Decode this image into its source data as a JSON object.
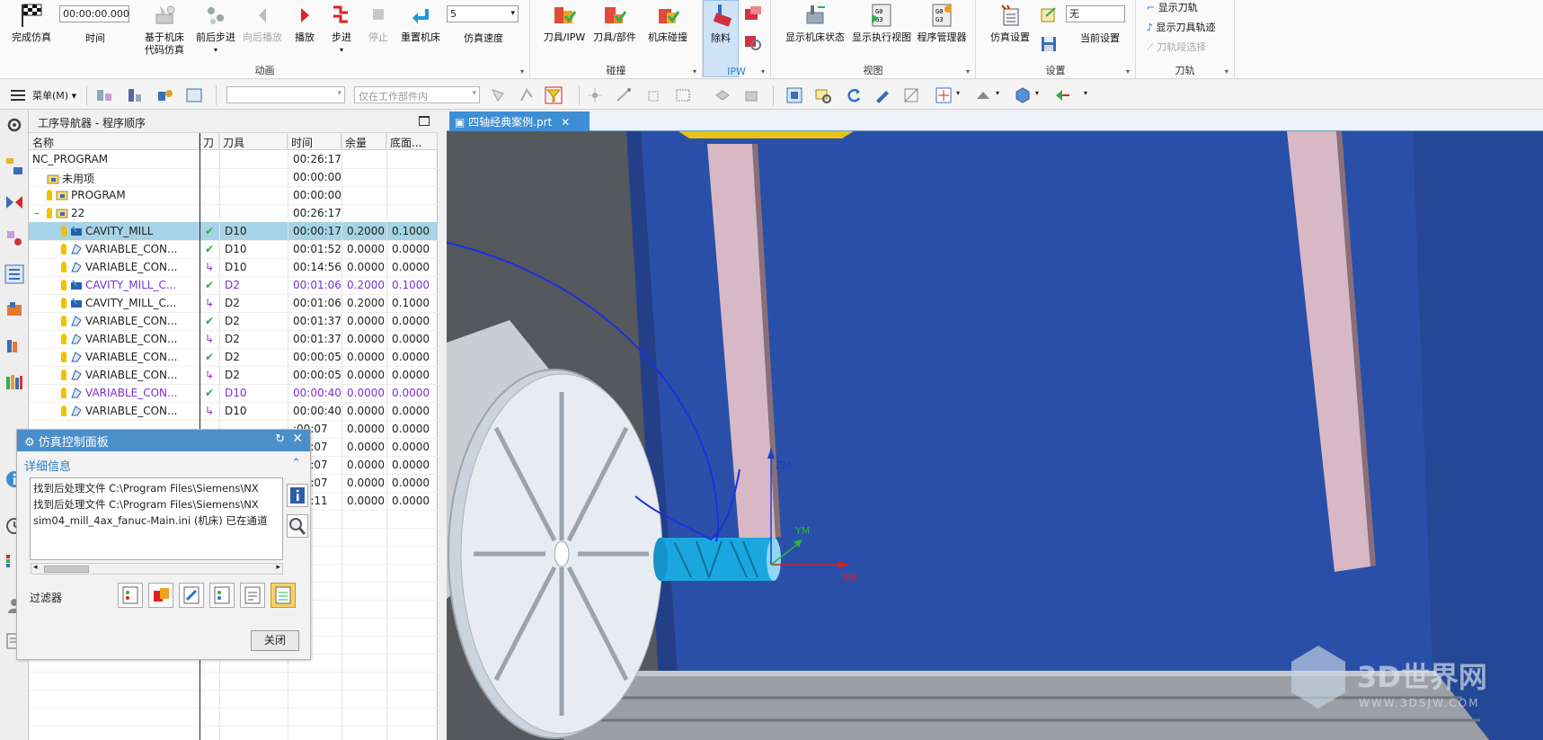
{
  "ribbon": {
    "buttons": {
      "finish": "完成仿真",
      "time": "时间",
      "time_value": "00:00:00.000",
      "machine_code": "基于机床\n代码仿真",
      "step_fwd_back": "前后步进",
      "back_play": "向后播放",
      "play": "播放",
      "step": "步进",
      "stop": "停止",
      "reset": "重置机床",
      "speed": "仿真速度",
      "speed_value": "5",
      "tool_ipw": "刀具/IPW",
      "tool_part": "刀具/部件",
      "machine_collision": "机床碰撞",
      "remove_material": "除料",
      "show_machine_state": "显示机床状态",
      "show_exec_view": "显示执行视图",
      "program_manager": "程序管理器",
      "sim_settings": "仿真设置",
      "current_settings": "当前设置",
      "none_value": "无",
      "show_toolpath": "显示刀轨",
      "show_tool_trace": "显示刀具轨迹",
      "toolpath_select": "刀轨段选择"
    },
    "groups": [
      "动画",
      "碰撞",
      "IPW",
      "视图",
      "设置",
      "刀轨"
    ]
  },
  "toolbar": {
    "menu": "菜单(M)",
    "filter_placeholder": "",
    "scope": "仅在工作部件内"
  },
  "navigator": {
    "title": "工序导航器 - 程序顺序",
    "columns": [
      "名称",
      "刀",
      "刀具",
      "时间",
      "余量",
      "底面..."
    ],
    "rows": [
      {
        "name": "NC_PROGRAM",
        "status": "",
        "tool": "",
        "time": "00:26:17",
        "stock": "",
        "floor": "",
        "indent": 0,
        "kind": "root"
      },
      {
        "name": "未用项",
        "status": "",
        "tool": "",
        "time": "00:00:00",
        "stock": "",
        "floor": "",
        "indent": 1,
        "kind": "group"
      },
      {
        "name": "PROGRAM",
        "status": "",
        "tool": "",
        "time": "00:00:00",
        "stock": "",
        "floor": "",
        "indent": 1,
        "kind": "group-bulb"
      },
      {
        "name": "22",
        "status": "",
        "tool": "",
        "time": "00:26:17",
        "stock": "",
        "floor": "",
        "indent": 1,
        "kind": "group-bulb-exp"
      },
      {
        "name": "CAVITY_MILL",
        "status": "ok",
        "tool": "D10",
        "time": "00:00:17",
        "stock": "0.2000",
        "floor": "0.1000",
        "indent": 2,
        "kind": "cav",
        "selected": true
      },
      {
        "name": "VARIABLE_CON...",
        "status": "ok",
        "tool": "D10",
        "time": "00:01:52",
        "stock": "0.0000",
        "floor": "0.0000",
        "indent": 2,
        "kind": "var"
      },
      {
        "name": "VARIABLE_CON...",
        "status": "arrow",
        "tool": "D10",
        "time": "00:14:56",
        "stock": "0.0000",
        "floor": "0.0000",
        "indent": 2,
        "kind": "var"
      },
      {
        "name": "CAVITY_MILL_C...",
        "status": "ok",
        "tool": "D2",
        "time": "00:01:06",
        "stock": "0.2000",
        "floor": "0.1000",
        "indent": 2,
        "kind": "cav",
        "purple": true
      },
      {
        "name": "CAVITY_MILL_C...",
        "status": "arrow",
        "tool": "D2",
        "time": "00:01:06",
        "stock": "0.2000",
        "floor": "0.1000",
        "indent": 2,
        "kind": "cav"
      },
      {
        "name": "VARIABLE_CON...",
        "status": "ok",
        "tool": "D2",
        "time": "00:01:37",
        "stock": "0.0000",
        "floor": "0.0000",
        "indent": 2,
        "kind": "var"
      },
      {
        "name": "VARIABLE_CON...",
        "status": "arrow",
        "tool": "D2",
        "time": "00:01:37",
        "stock": "0.0000",
        "floor": "0.0000",
        "indent": 2,
        "kind": "var"
      },
      {
        "name": "VARIABLE_CON...",
        "status": "ok",
        "tool": "D2",
        "time": "00:00:05",
        "stock": "0.0000",
        "floor": "0.0000",
        "indent": 2,
        "kind": "var"
      },
      {
        "name": "VARIABLE_CON...",
        "status": "arrow",
        "tool": "D2",
        "time": "00:00:05",
        "stock": "0.0000",
        "floor": "0.0000",
        "indent": 2,
        "kind": "var"
      },
      {
        "name": "VARIABLE_CON...",
        "status": "ok",
        "tool": "D10",
        "time": "00:00:40",
        "stock": "0.0000",
        "floor": "0.0000",
        "indent": 2,
        "kind": "var",
        "purple": true
      },
      {
        "name": "VARIABLE_CON...",
        "status": "arrow",
        "tool": "D10",
        "time": "00:00:40",
        "stock": "0.0000",
        "floor": "0.0000",
        "indent": 2,
        "kind": "var"
      },
      {
        "name": "",
        "status": "",
        "tool": "",
        "time": ":00:07",
        "stock": "0.0000",
        "floor": "0.0000",
        "indent": 2,
        "kind": "hidden"
      },
      {
        "name": "",
        "status": "",
        "tool": "",
        "time": ":00:07",
        "stock": "0.0000",
        "floor": "0.0000",
        "indent": 2,
        "kind": "hidden"
      },
      {
        "name": "",
        "status": "",
        "tool": "",
        "time": ":00:07",
        "stock": "0.0000",
        "floor": "0.0000",
        "indent": 2,
        "kind": "hidden"
      },
      {
        "name": "",
        "status": "",
        "tool": "",
        "time": ":01:07",
        "stock": "0.0000",
        "floor": "0.0000",
        "indent": 2,
        "kind": "hidden"
      },
      {
        "name": "",
        "status": "",
        "tool": "",
        "time": ":00:11",
        "stock": "0.0000",
        "floor": "0.0000",
        "indent": 2,
        "kind": "hidden"
      }
    ]
  },
  "graphics": {
    "tab_label": "四轴经典案例.prt",
    "axis_zm": "ZM",
    "axis_ym": "YM",
    "axis_xm": "XM",
    "watermark_main": "3D世界网",
    "watermark_sub": "WWW.3DSJW.COM"
  },
  "sim_panel": {
    "title": "仿真控制面板",
    "section": "详细信息",
    "messages": [
      "找到后处理文件 C:\\Program Files\\Siemens\\NX",
      "找到后处理文件 C:\\Program Files\\Siemens\\NX",
      "sim04_mill_4ax_fanuc-Main.ini (机床) 已在通道"
    ],
    "filter_label": "过滤器",
    "close_label": "关闭"
  },
  "colors": {
    "bg_blue": "#2a4fa8",
    "selection": "#a7d3e6",
    "accent": "#4a8fc9"
  }
}
